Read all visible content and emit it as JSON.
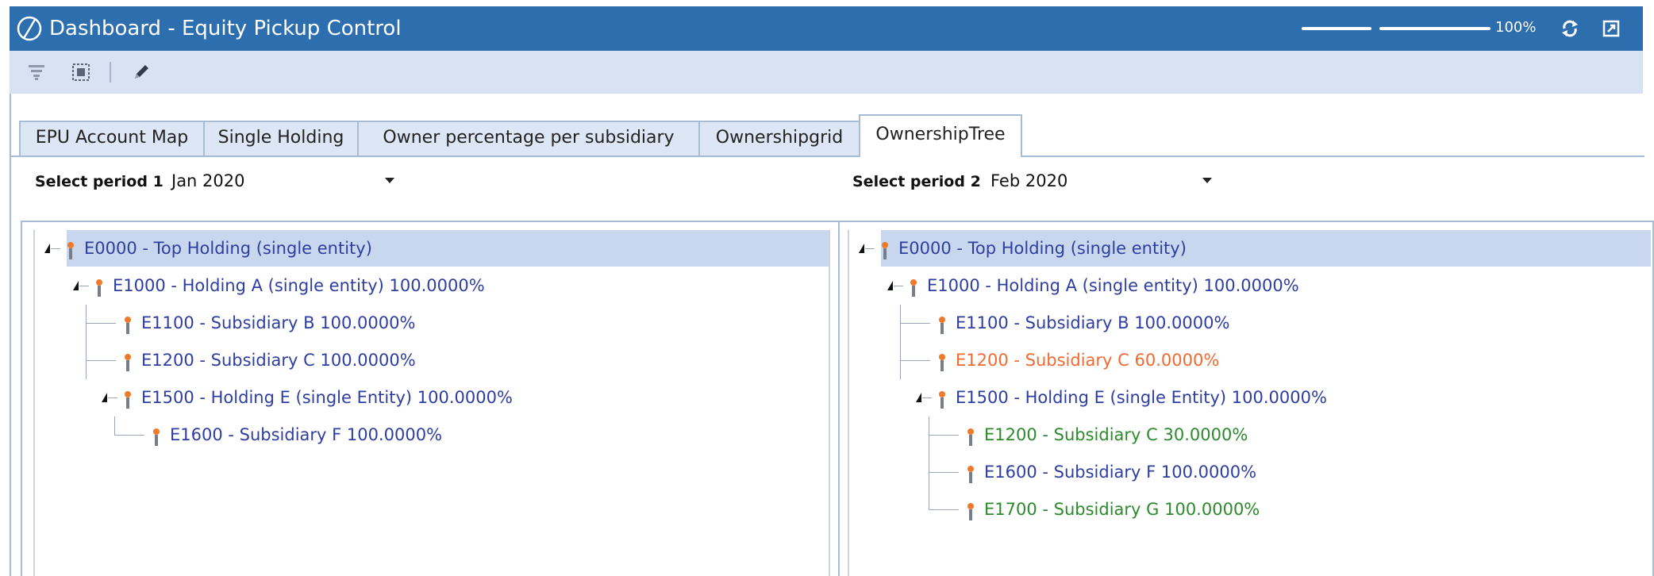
{
  "window": {
    "title": "Dashboard - Equity Pickup Control",
    "zoom_label": "100%"
  },
  "tabs": [
    {
      "label": "EPU Account Map",
      "active": false
    },
    {
      "label": "Single Holding",
      "active": false
    },
    {
      "label": "Owner percentage per subsidiary",
      "active": false
    },
    {
      "label": "Ownershipgrid",
      "active": false
    },
    {
      "label": "OwnershipTree",
      "active": true
    }
  ],
  "period1": {
    "label": "Select period 1",
    "value": "Jan 2020"
  },
  "period2": {
    "label": "Select period 2",
    "value": "Feb 2020"
  },
  "tree1": {
    "nodes": [
      {
        "text": "E0000 - Top Holding (single entity)",
        "level": 0,
        "status": "normal",
        "selected": true
      },
      {
        "text": "E1000 - Holding A (single entity)  100.0000%",
        "level": 1,
        "status": "normal"
      },
      {
        "text": "E1100 - Subsidiary B  100.0000%",
        "level": 2,
        "status": "normal"
      },
      {
        "text": "E1200 - Subsidiary C  100.0000%",
        "level": 2,
        "status": "normal"
      },
      {
        "text": "E1500 - Holding E (single Entity)  100.0000%",
        "level": 2,
        "status": "normal"
      },
      {
        "text": "E1600 - Subsidiary F  100.0000%",
        "level": 3,
        "status": "normal"
      }
    ]
  },
  "tree2": {
    "nodes": [
      {
        "text": "E0000 - Top Holding (single entity)",
        "level": 0,
        "status": "normal",
        "selected": true
      },
      {
        "text": "E1000 - Holding A (single entity)  100.0000%",
        "level": 1,
        "status": "normal"
      },
      {
        "text": "E1100 - Subsidiary B  100.0000%",
        "level": 2,
        "status": "normal"
      },
      {
        "text": "E1200 - Subsidiary C  60.0000%",
        "level": 2,
        "status": "changed"
      },
      {
        "text": "E1500 - Holding E (single Entity)  100.0000%",
        "level": 2,
        "status": "normal"
      },
      {
        "text": "E1200 - Subsidiary C  30.0000%",
        "level": 3,
        "status": "added"
      },
      {
        "text": "E1600 - Subsidiary F  100.0000%",
        "level": 3,
        "status": "normal"
      },
      {
        "text": "E1700 - Subsidiary G  100.0000%",
        "level": 3,
        "status": "added"
      }
    ]
  },
  "colors": {
    "titlebar": "#2d6fae",
    "toolbar": "#d7e2f2",
    "normal_text": "#2e3ea0",
    "changed_text": "#f26a2f",
    "added_text": "#2c8a2c",
    "selected_row": "#c8d7ee"
  },
  "icons": {
    "app_logo": "app-logo-icon",
    "refresh": "refresh-icon",
    "popout": "popout-icon",
    "filter": "filter-icon",
    "select": "select-icon",
    "edit": "pencil-icon",
    "node": "entity-pin-icon"
  }
}
